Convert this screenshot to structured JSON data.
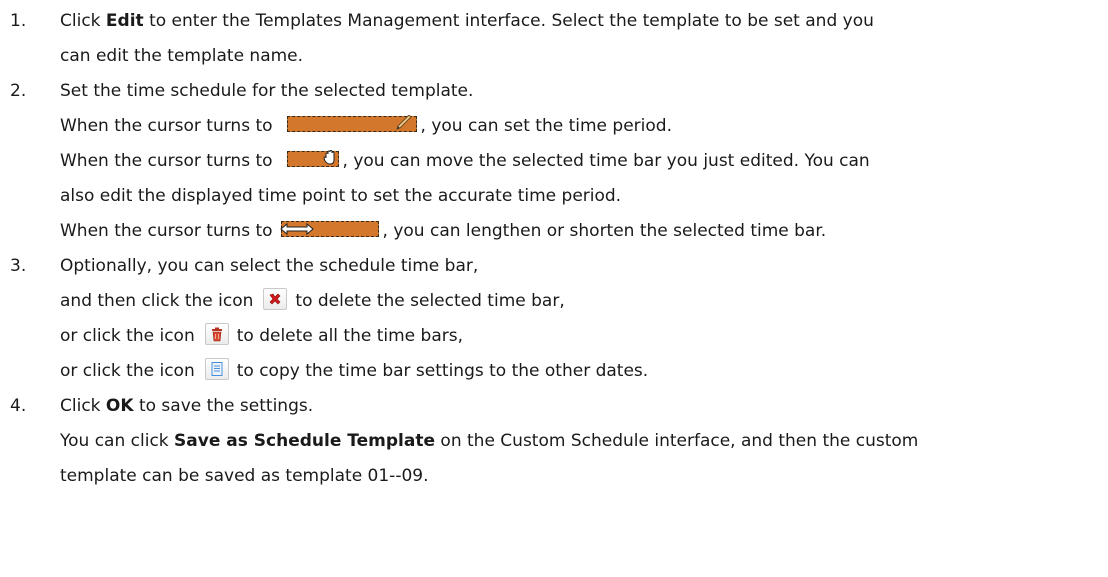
{
  "steps": [
    {
      "num": "1.",
      "lines": [
        {
          "pre": "Click ",
          "bold": "Edit",
          "post": " to enter the Templates Management interface. Select the template to be set and you"
        },
        {
          "text": "can edit the template name."
        }
      ]
    },
    {
      "num": "2.",
      "lines": [
        {
          "text": "Set the time schedule for the selected template."
        },
        {
          "pre": "When the cursor turns to",
          "post": ", you can set the time period.",
          "icon": "pencil-draw-cursor-icon"
        },
        {
          "pre": "When the cursor turns to",
          "post": ", you can move the selected time bar you just edited. You can",
          "icon": "hand-move-cursor-icon"
        },
        {
          "text": "also edit the displayed time point to set the accurate time period."
        },
        {
          "pre": "When the cursor turns to",
          "post": ", you can lengthen or shorten the selected time bar.",
          "icon": "resize-arrow-cursor-icon"
        }
      ]
    },
    {
      "num": "3.",
      "lines": [
        {
          "text": "Optionally, you can select the schedule time bar,"
        },
        {
          "pre": "and then click the icon",
          "post": "to delete the selected time bar,",
          "icon": "delete-x-icon"
        },
        {
          "pre": "or click the icon",
          "post": "to delete all the time bars,",
          "icon": "trash-icon"
        },
        {
          "pre": "or click the icon",
          "post": "to copy the time bar settings to the other dates.",
          "icon": "copy-icon"
        }
      ]
    },
    {
      "num": "4.",
      "lines": [
        {
          "pre": "Click ",
          "bold": "OK",
          "post": " to save the settings."
        },
        {
          "pre": "You can click ",
          "bold": "Save as Schedule Template",
          "post": " on the Custom Schedule interface, and then the custom"
        },
        {
          "text": "template can be saved as template 01--09."
        }
      ]
    }
  ],
  "colors": {
    "time_bar": "#d2772b",
    "delete_x": "#d01a1a",
    "trash": "#c0392b",
    "copy": "#4a90d9"
  }
}
